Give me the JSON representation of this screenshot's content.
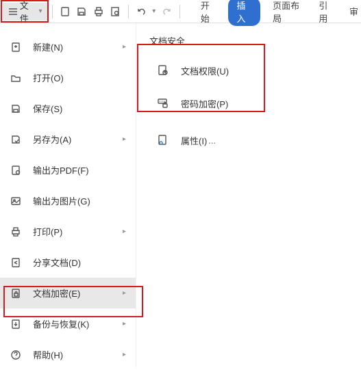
{
  "toolbar": {
    "file_label": "文件"
  },
  "tabs": {
    "start": "开始",
    "insert": "插入",
    "layout": "页面布局",
    "refs": "引用",
    "review": "审"
  },
  "menu": {
    "new": "新建(N)",
    "open": "打开(O)",
    "save": "保存(S)",
    "saveas": "另存为(A)",
    "pdf": "输出为PDF(F)",
    "image": "输出为图片(G)",
    "print": "打印(P)",
    "share": "分享文档(D)",
    "encrypt": "文档加密(E)",
    "backup": "备份与恢复(K)",
    "help": "帮助(H)"
  },
  "submenu": {
    "title": "文档安全",
    "perm": "文档权限(U)",
    "password": "密码加密(P)",
    "properties": "属性(I)",
    "ellipsis": "..."
  }
}
